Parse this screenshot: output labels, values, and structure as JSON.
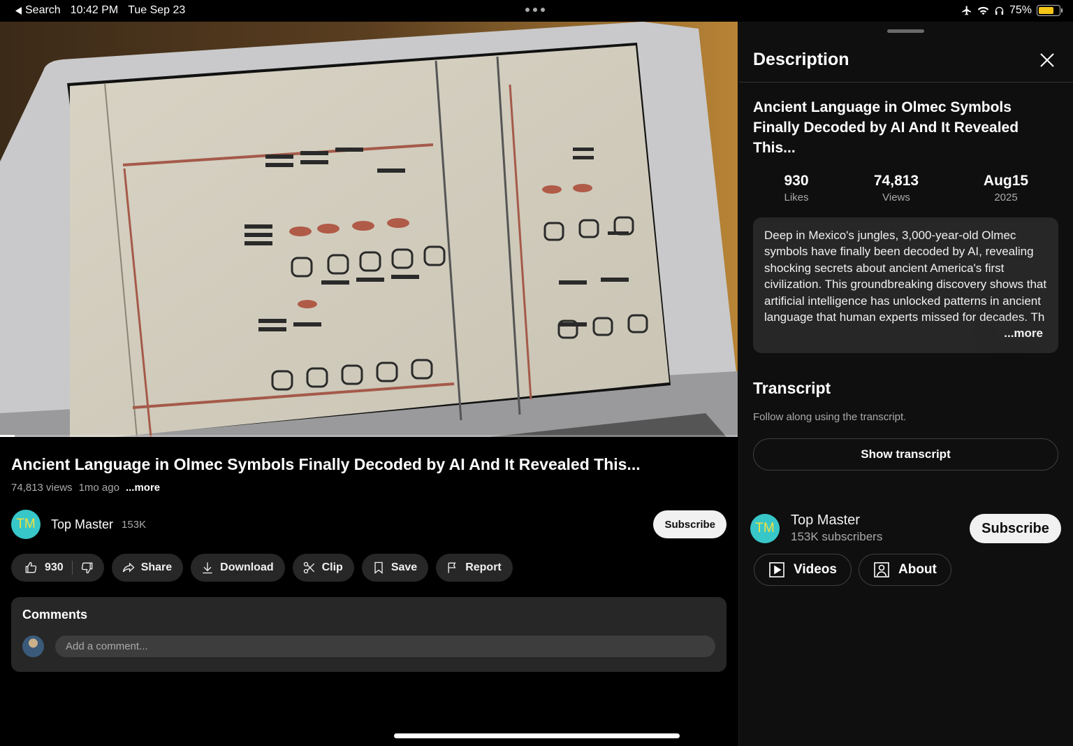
{
  "status_bar": {
    "back_label": "Search",
    "time": "10:42 PM",
    "date": "Tue Sep 23",
    "battery_percent": "75%",
    "battery_level": 0.75,
    "icons": [
      "airplane-icon",
      "wifi-icon",
      "headphones-icon",
      "battery-icon"
    ]
  },
  "video": {
    "progress": 0.02
  },
  "main": {
    "title": "Ancient Language in Olmec Symbols Finally Decoded by AI And It Revealed This...",
    "views": "74,813 views",
    "age": "1mo ago",
    "more_label": "...more",
    "channel": {
      "initials": "TM",
      "name": "Top Master",
      "subscribers": "153K",
      "subscribe_label": "Subscribe"
    },
    "actions": {
      "like_count": "930",
      "share": "Share",
      "download": "Download",
      "clip": "Clip",
      "save": "Save",
      "report": "Report"
    },
    "comments": {
      "title": "Comments",
      "placeholder": "Add a comment..."
    }
  },
  "panel": {
    "header": "Description",
    "title": "Ancient Language in Olmec Symbols Finally Decoded by AI And It Revealed This...",
    "stats": [
      {
        "value": "930",
        "label": "Likes"
      },
      {
        "value": "74,813",
        "label": "Views"
      },
      {
        "value": "Aug15",
        "label": "2025"
      }
    ],
    "description": "Deep in Mexico's jungles, 3,000-year-old Olmec symbols have finally been decoded by AI, revealing shocking secrets about ancient America's first civilization. This groundbreaking discovery shows that artificial intelligence has unlocked patterns in ancient language that human experts missed for decades. Th",
    "more_label": "...more",
    "transcript": {
      "title": "Transcript",
      "subtitle": "Follow along using the transcript.",
      "button": "Show transcript"
    },
    "channel": {
      "initials": "TM",
      "name": "Top Master",
      "subscribers": "153K subscribers",
      "subscribe_label": "Subscribe"
    },
    "tabs": [
      {
        "label": "Videos",
        "icon": "play-box-icon"
      },
      {
        "label": "About",
        "icon": "person-icon"
      }
    ]
  },
  "colors": {
    "background": "#000000",
    "panel": "#0f0f0f",
    "chip": "#272727",
    "avatar": "#38c7c9",
    "battery": "#f5c518"
  }
}
